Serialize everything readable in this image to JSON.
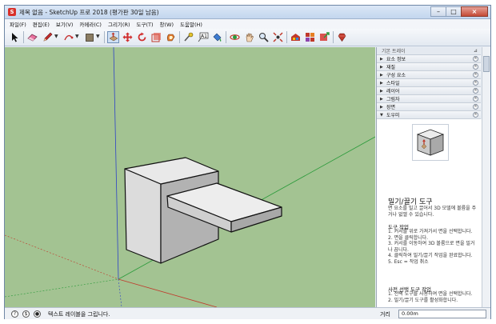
{
  "window": {
    "title": "제목 없음 - SketchUp 프로 2018 (평가판 30일 남음)"
  },
  "menu": [
    "파일(F)",
    "편집(E)",
    "보기(V)",
    "카메라(C)",
    "그리기(R)",
    "도구(T)",
    "창(W)",
    "도움말(H)"
  ],
  "toolbar": {
    "tools": [
      "select-arrow-icon",
      "eraser-icon",
      "pencil-icon",
      "arc-icon",
      "shape-icon",
      "pushpull-icon",
      "move-icon",
      "rotate-icon",
      "scale-icon",
      "offset-icon",
      "tape-measure-icon",
      "text-icon",
      "paint-bucket-icon",
      "orbit-icon",
      "pan-icon",
      "zoom-icon",
      "zoom-extents-icon",
      "warehouse-icon",
      "extension-icon",
      "share-icon",
      "ruby-icon"
    ]
  },
  "tray": {
    "title": "기본 트레이",
    "panels": [
      {
        "label": "요소 정보",
        "expanded": false
      },
      {
        "label": "재질",
        "expanded": false
      },
      {
        "label": "구성 요소",
        "expanded": false
      },
      {
        "label": "스타일",
        "expanded": false
      },
      {
        "label": "레이어",
        "expanded": false
      },
      {
        "label": "그림자",
        "expanded": false
      },
      {
        "label": "장면",
        "expanded": false
      },
      {
        "label": "도우미",
        "expanded": true
      }
    ]
  },
  "instructor": {
    "title": "밀기/끌기 도구",
    "description": "면 요소를 밀고 끌어서 3D 모델에 볼륨을 주거나 없앨 수 있습니다.",
    "section1_title": "도구 작업",
    "section1_items": [
      "1. 커서를 위로 가져가서 면을 선택합니다.",
      "2. 면을 클릭합니다.",
      "3. 커서를 이동하여 3D 볼륨으로 면을 밀거나 끕니다.",
      "4. 클릭하여 밀기/끌기 작업을 완료합니다.",
      "5. Esc = 작업 취소"
    ],
    "section2_title": "사전 선택 도구 작업",
    "section2_items": [
      "1. 선택 도구를 사용하여 면을 선택합니다.",
      "2. 밀기/끌기 도구를 활성화합니다."
    ]
  },
  "statusbar": {
    "text": "텍스트 레이블을 그립니다.",
    "measure_label": "거리",
    "measure_value": "0.00m"
  },
  "colors": {
    "viewport_bg": "#a3c392",
    "axis_red": "#c0392b",
    "axis_green": "#2a9a3a",
    "axis_blue": "#2e42c7"
  }
}
